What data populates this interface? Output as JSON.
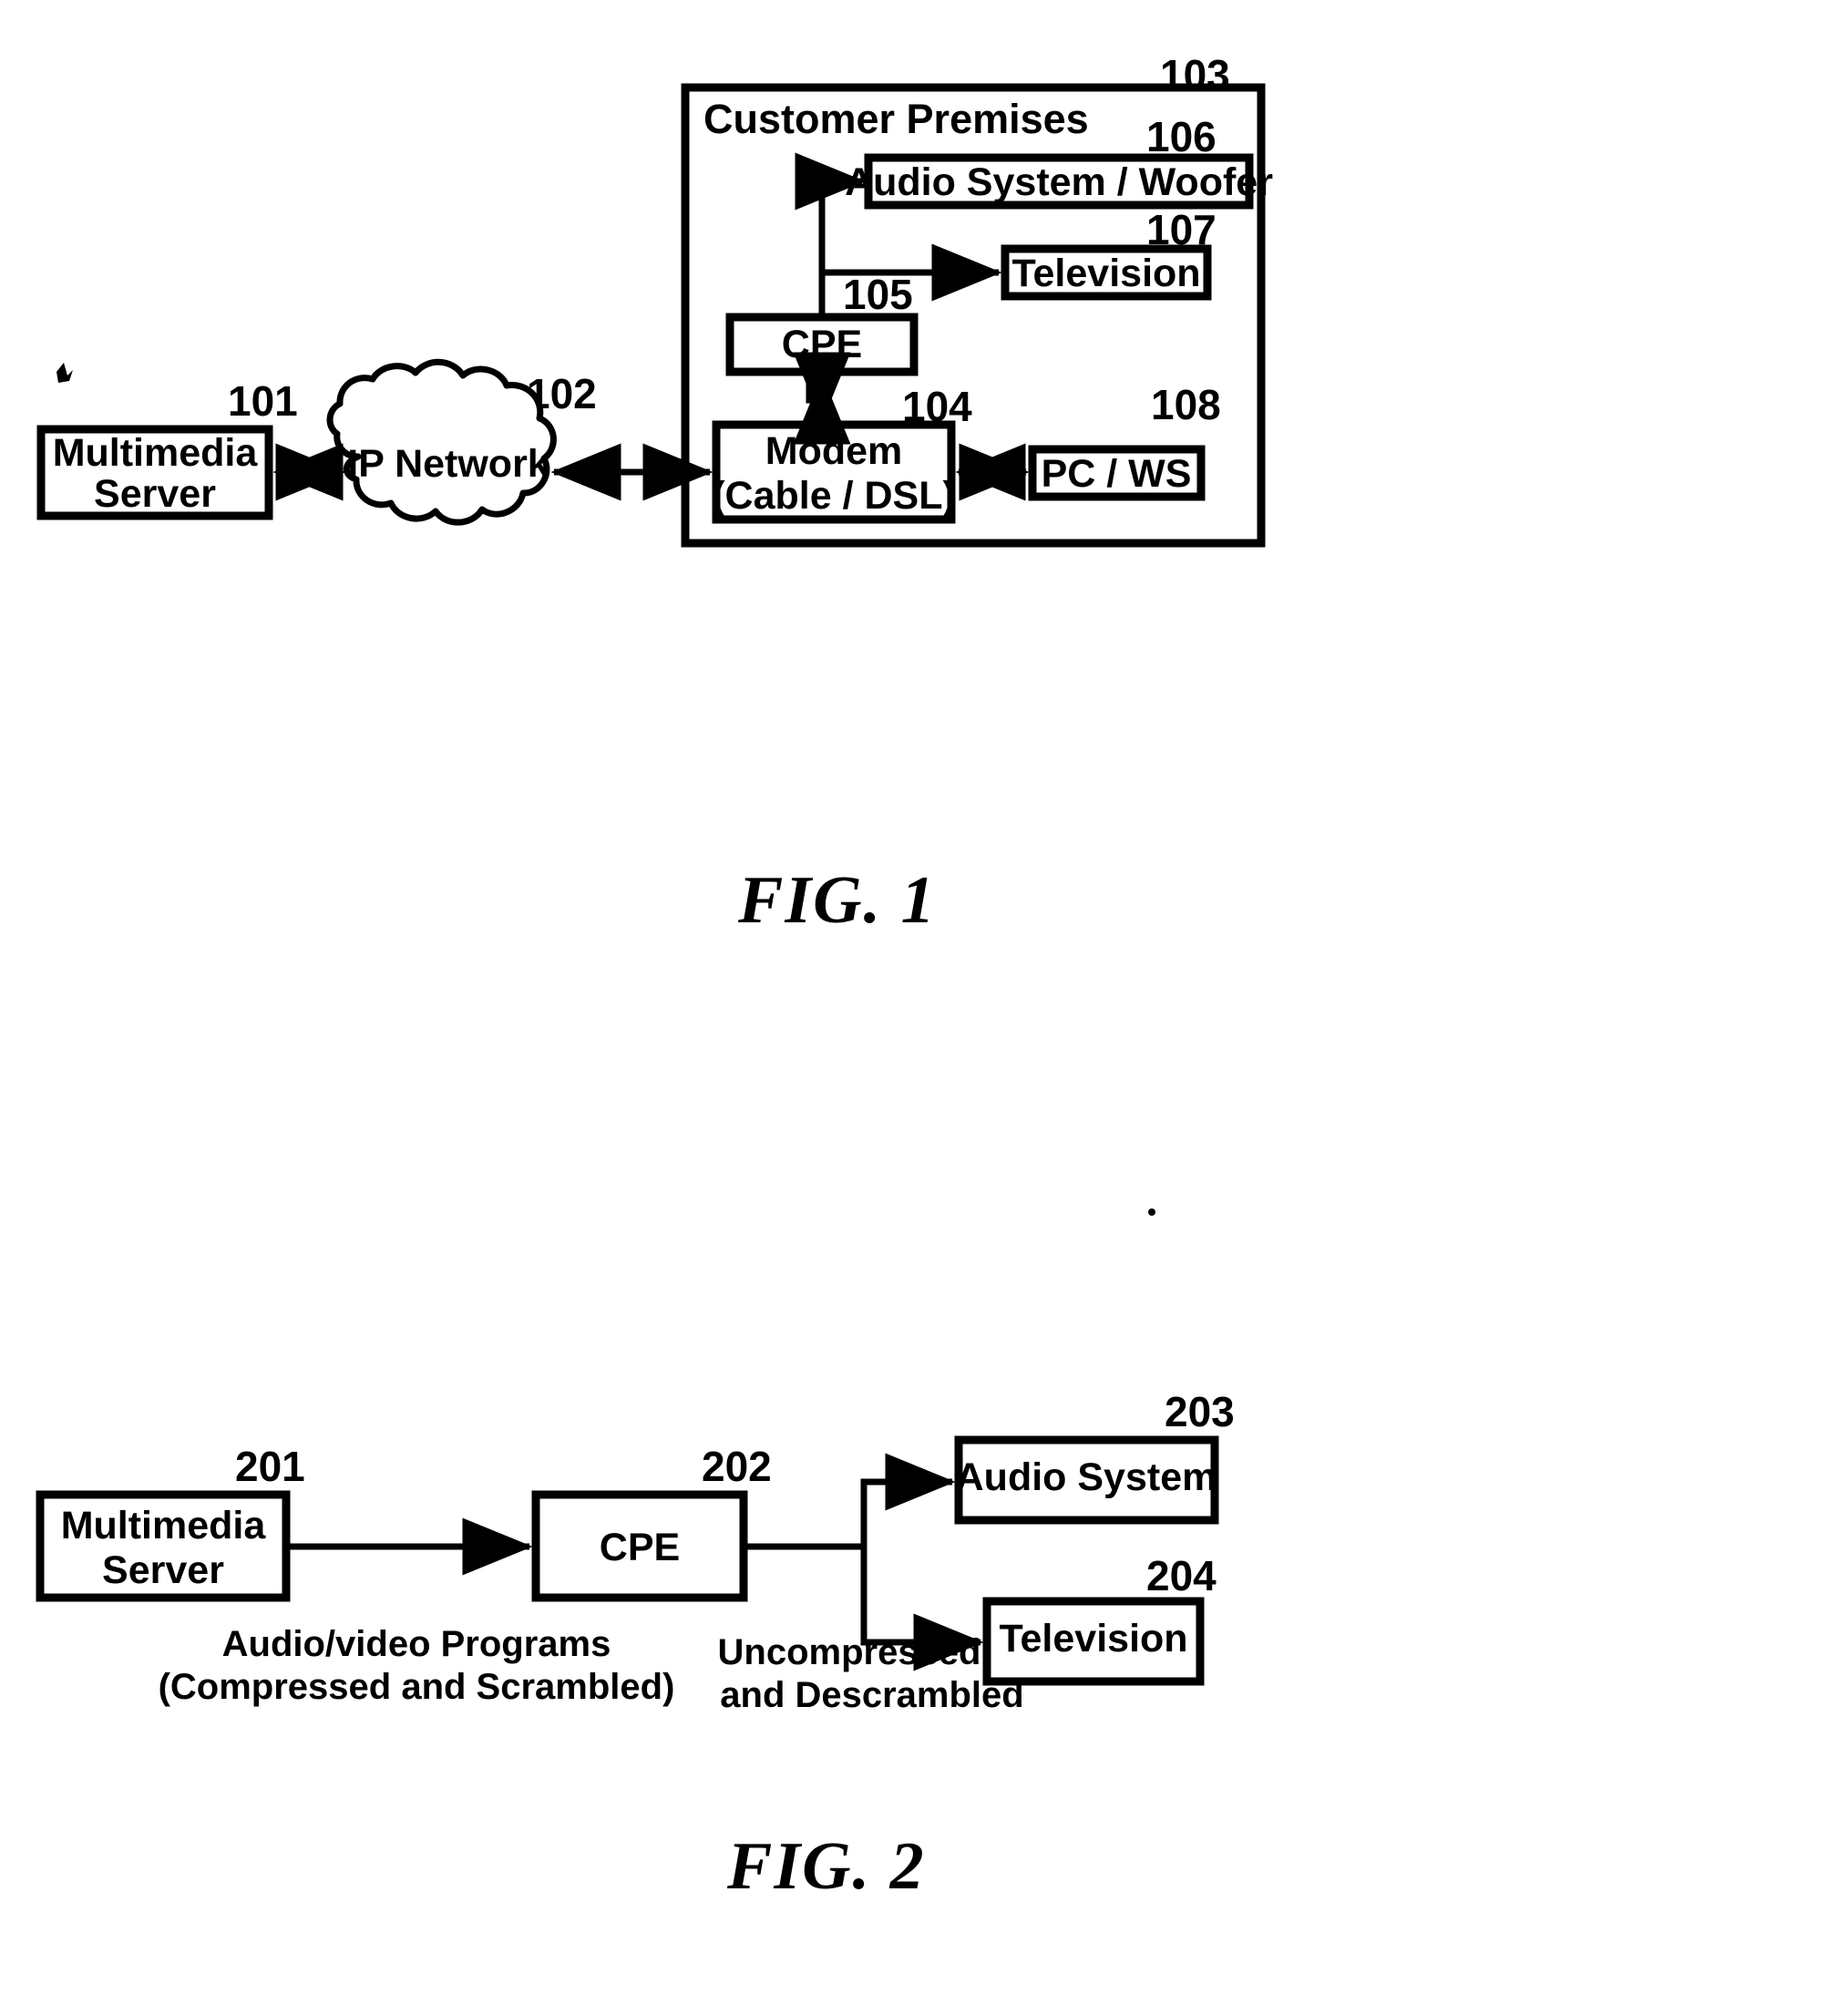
{
  "sheet": {
    "background_color": "#ffffff",
    "ink_color": "#000000"
  },
  "figure1": {
    "caption": "FIG. 1",
    "container": {
      "ref": "103",
      "title": "Customer Premises"
    },
    "nodes": [
      {
        "id": "multimedia-server",
        "ref": "101",
        "line1": "Multimedia",
        "line2": "Server"
      },
      {
        "id": "ip-network",
        "ref": "102",
        "label": "IP Network"
      },
      {
        "id": "modem",
        "ref": "104",
        "line1": "Modem",
        "line2": "(Cable / DSL)"
      },
      {
        "id": "cpe",
        "ref": "105",
        "label": "CPE"
      },
      {
        "id": "audio-system-woofer",
        "ref": "106",
        "label": "Audio System / Woofer"
      },
      {
        "id": "television",
        "ref": "107",
        "label": "Television"
      },
      {
        "id": "pc-ws",
        "ref": "108",
        "label": "PC / WS"
      }
    ],
    "connections": [
      {
        "from": "multimedia-server",
        "to": "ip-network",
        "style": "bidirectional"
      },
      {
        "from": "ip-network",
        "to": "modem",
        "style": "bidirectional"
      },
      {
        "from": "modem",
        "to": "pc-ws",
        "style": "bidirectional"
      },
      {
        "from": "modem",
        "to": "cpe",
        "style": "bidirectional-zigzag"
      },
      {
        "from": "cpe",
        "to": "audio-system-woofer",
        "style": "arrow"
      },
      {
        "from": "cpe",
        "to": "television",
        "style": "arrow"
      }
    ]
  },
  "figure2": {
    "caption": "FIG. 2",
    "nodes": [
      {
        "id": "multimedia-server",
        "ref": "201",
        "line1": "Multimedia",
        "line2": "Server"
      },
      {
        "id": "cpe",
        "ref": "202",
        "label": "CPE"
      },
      {
        "id": "audio-system",
        "ref": "203",
        "label": "Audio System"
      },
      {
        "id": "television",
        "ref": "204",
        "label": "Television"
      }
    ],
    "flow_labels": {
      "input": {
        "line1": "Audio/video Programs",
        "line2": "(Compressed and Scrambled)"
      },
      "output": {
        "line1": "Uncompressed",
        "line2": "and Descrambled"
      }
    },
    "connections": [
      {
        "from": "multimedia-server",
        "to": "cpe",
        "style": "arrow"
      },
      {
        "from": "cpe",
        "to": "audio-system",
        "style": "arrow"
      },
      {
        "from": "cpe",
        "to": "television",
        "style": "arrow"
      }
    ]
  }
}
